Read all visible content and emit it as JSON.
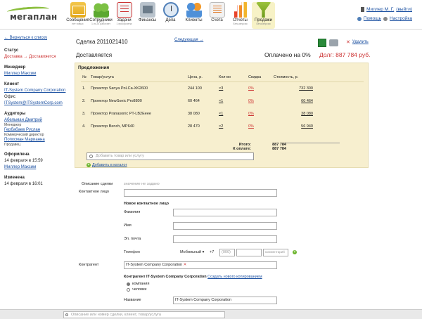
{
  "app": {
    "logo_text": "мегаплан"
  },
  "nav": [
    {
      "label": "Сообщения",
      "sub": "нет новых",
      "icon": "envelope-icon"
    },
    {
      "label": "Сотрудники",
      "sub": "1 из 24 работает",
      "icon": "people-icon"
    },
    {
      "label": "Задачи",
      "sub": "1 просрочена",
      "icon": "tasks-icon"
    },
    {
      "label": "Финансы",
      "sub": "",
      "icon": "finance-icon"
    },
    {
      "label": "Дела",
      "sub": "",
      "icon": "clock-icon"
    },
    {
      "label": "Клиенты",
      "sub": "",
      "icon": "clients-icon"
    },
    {
      "label": "Счета",
      "sub": "",
      "icon": "invoices-icon"
    },
    {
      "label": "Отчеты",
      "sub": "Бета-версия",
      "icon": "reports-icon"
    },
    {
      "label": "Продажи",
      "sub": "Бета-версия",
      "icon": "funnel-icon"
    }
  ],
  "user": {
    "name": "Миллер М. Г.",
    "logout": "(выйти)",
    "help": "Помощь",
    "settings": "Настройка"
  },
  "sidebar": {
    "back_link": "← Вернуться к списку",
    "status_label": "Статус",
    "status_value": "Доставка → Доставляется",
    "manager_label": "Менеджер",
    "manager_value": "Миллер Максим",
    "client_label": "Клиент",
    "client_name": "IT-System Company Corporation",
    "client_office": "Офис",
    "client_email": "ITSystem@ITSystemCorp.com",
    "auditors_label": "Аудиторы",
    "auditor1_name": "Абельман Дмитрий",
    "auditor1_role": "Менеджер",
    "auditor2_name": "Гербабаев Руслан",
    "auditor2_role": "Коммерческий директор",
    "auditor3_name": "Попусман Марианна",
    "auditor3_role": "Продавец",
    "issued_label": "Оформлена",
    "issued_date": "14 февраля в 15:59",
    "issued_by": "Миллер Максим",
    "changed_label": "Изменена",
    "changed_date": "14 февраля в 16:01"
  },
  "deal": {
    "title": "Сделка 2011021410",
    "next_link": "Следующая →",
    "delete_label": "Удалить",
    "status_text": "Доставляется",
    "paid_text": "Оплачено на 0%",
    "debt_text": "Долг: 887 784 руб."
  },
  "offers": {
    "title": "Предложения",
    "columns": [
      "№",
      "Товар/услуга",
      "Цена, р.",
      "Кол-во",
      "Скидка",
      "Стоимость, р."
    ],
    "rows": [
      {
        "n": "1.",
        "name": "Проектор Sanya PoLCa-XK2600",
        "price": "244 100",
        "qty": "×3",
        "discount": "0%",
        "cost": "732 300"
      },
      {
        "n": "2.",
        "name": "Проектор NewSonic Pro8800",
        "price": "60 464",
        "qty": "×1",
        "discount": "0%",
        "cost": "60 464"
      },
      {
        "n": "3.",
        "name": "Проектор Pranasonic PT-LB2Eeee",
        "price": "38 080",
        "qty": "×1",
        "discount": "0%",
        "cost": "38 080"
      },
      {
        "n": "4.",
        "name": "Проектор Bench, MP640",
        "price": "28 470",
        "qty": "×2",
        "discount": "0%",
        "cost": "56 940"
      }
    ],
    "total_label": "Итого:",
    "total_value": "887 784",
    "to_pay_label": "К оплате:",
    "to_pay_value": "887 784",
    "add_placeholder": "Добавить товар или услугу",
    "add_catalog": "Добавить в каталог"
  },
  "form": {
    "description_label": "Описание сделки",
    "description_hint": "значение не задано",
    "contact_label": "Контактное лицо",
    "new_contact_title": "Новое контактное лицо",
    "surname_label": "Фамилия",
    "name_label": "Имя",
    "email_label": "Эл. почта",
    "phone_label": "Телефон",
    "phone_type": "Мобильный ▾",
    "phone_code": "+7",
    "phone_area_ph": "(000)",
    "phone_comment_ph": "комментарий",
    "counterparty_label": "Контрагент",
    "counterparty_value": "IT-System Company Corporation",
    "counterparty_sub": "Контрагент IT-System Company Corporation",
    "create_copy": "Создать нового копированием",
    "radio_company": "компания",
    "radio_person": "человек",
    "title_label": "Название",
    "title_value": "IT-System Company Corporation"
  },
  "bottom": {
    "search_placeholder": "Описание или номер сделки, клиент, товар/услуга"
  }
}
